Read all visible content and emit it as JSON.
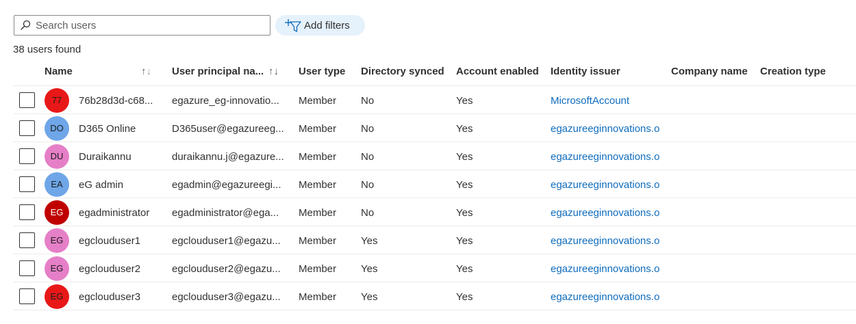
{
  "search": {
    "placeholder": "Search users",
    "icon": "search-icon"
  },
  "filters": {
    "label": "Add filters",
    "icon": "add-filter-icon"
  },
  "results": {
    "count_text": "38 users found"
  },
  "columns": {
    "name": "Name",
    "upn": "User principal na...",
    "user_type": "User type",
    "dir_synced": "Directory synced",
    "account_enabled": "Account enabled",
    "identity_issuer": "Identity issuer",
    "company_name": "Company name",
    "creation_type": "Creation type"
  },
  "sort_glyphs": {
    "up": "↑",
    "down": "↓"
  },
  "colors": {
    "link": "#0f6cbd",
    "filter_bg": "#e5f1fb",
    "border": "#8a8886"
  },
  "rows": [
    {
      "initials": "77",
      "avatar_color": "#e81818",
      "avatar_dark": false,
      "name": "76b28d3d-c68...",
      "upn": "egazure_eg-innovatio...",
      "user_type": "Member",
      "dir_synced": "No",
      "account_enabled": "Yes",
      "identity_issuer": "MicrosoftAccount"
    },
    {
      "initials": "DO",
      "avatar_color": "#6ea6e8",
      "avatar_dark": false,
      "name": "D365 Online",
      "upn": "D365user@egazureeg...",
      "user_type": "Member",
      "dir_synced": "No",
      "account_enabled": "Yes",
      "identity_issuer": "egazureeginnovations.o"
    },
    {
      "initials": "DU",
      "avatar_color": "#e57fc7",
      "avatar_dark": false,
      "name": "Duraikannu",
      "upn": "duraikannu.j@egazure...",
      "user_type": "Member",
      "dir_synced": "No",
      "account_enabled": "Yes",
      "identity_issuer": "egazureeginnovations.o"
    },
    {
      "initials": "EA",
      "avatar_color": "#6ea6e8",
      "avatar_dark": false,
      "name": "eG admin",
      "upn": "egadmin@egazureegi...",
      "user_type": "Member",
      "dir_synced": "No",
      "account_enabled": "Yes",
      "identity_issuer": "egazureeginnovations.o"
    },
    {
      "initials": "EG",
      "avatar_color": "#c00000",
      "avatar_dark": true,
      "name": "egadministrator",
      "upn": "egadministrator@ega...",
      "user_type": "Member",
      "dir_synced": "No",
      "account_enabled": "Yes",
      "identity_issuer": "egazureeginnovations.o"
    },
    {
      "initials": "EG",
      "avatar_color": "#e57fc7",
      "avatar_dark": false,
      "name": "egclouduser1",
      "upn": "egclouduser1@egazu...",
      "user_type": "Member",
      "dir_synced": "Yes",
      "account_enabled": "Yes",
      "identity_issuer": "egazureeginnovations.o"
    },
    {
      "initials": "EG",
      "avatar_color": "#e57fc7",
      "avatar_dark": false,
      "name": "egclouduser2",
      "upn": "egclouduser2@egazu...",
      "user_type": "Member",
      "dir_synced": "Yes",
      "account_enabled": "Yes",
      "identity_issuer": "egazureeginnovations.o"
    },
    {
      "initials": "EG",
      "avatar_color": "#e81818",
      "avatar_dark": false,
      "name": "egclouduser3",
      "upn": "egclouduser3@egazu...",
      "user_type": "Member",
      "dir_synced": "Yes",
      "account_enabled": "Yes",
      "identity_issuer": "egazureeginnovations.o"
    }
  ]
}
